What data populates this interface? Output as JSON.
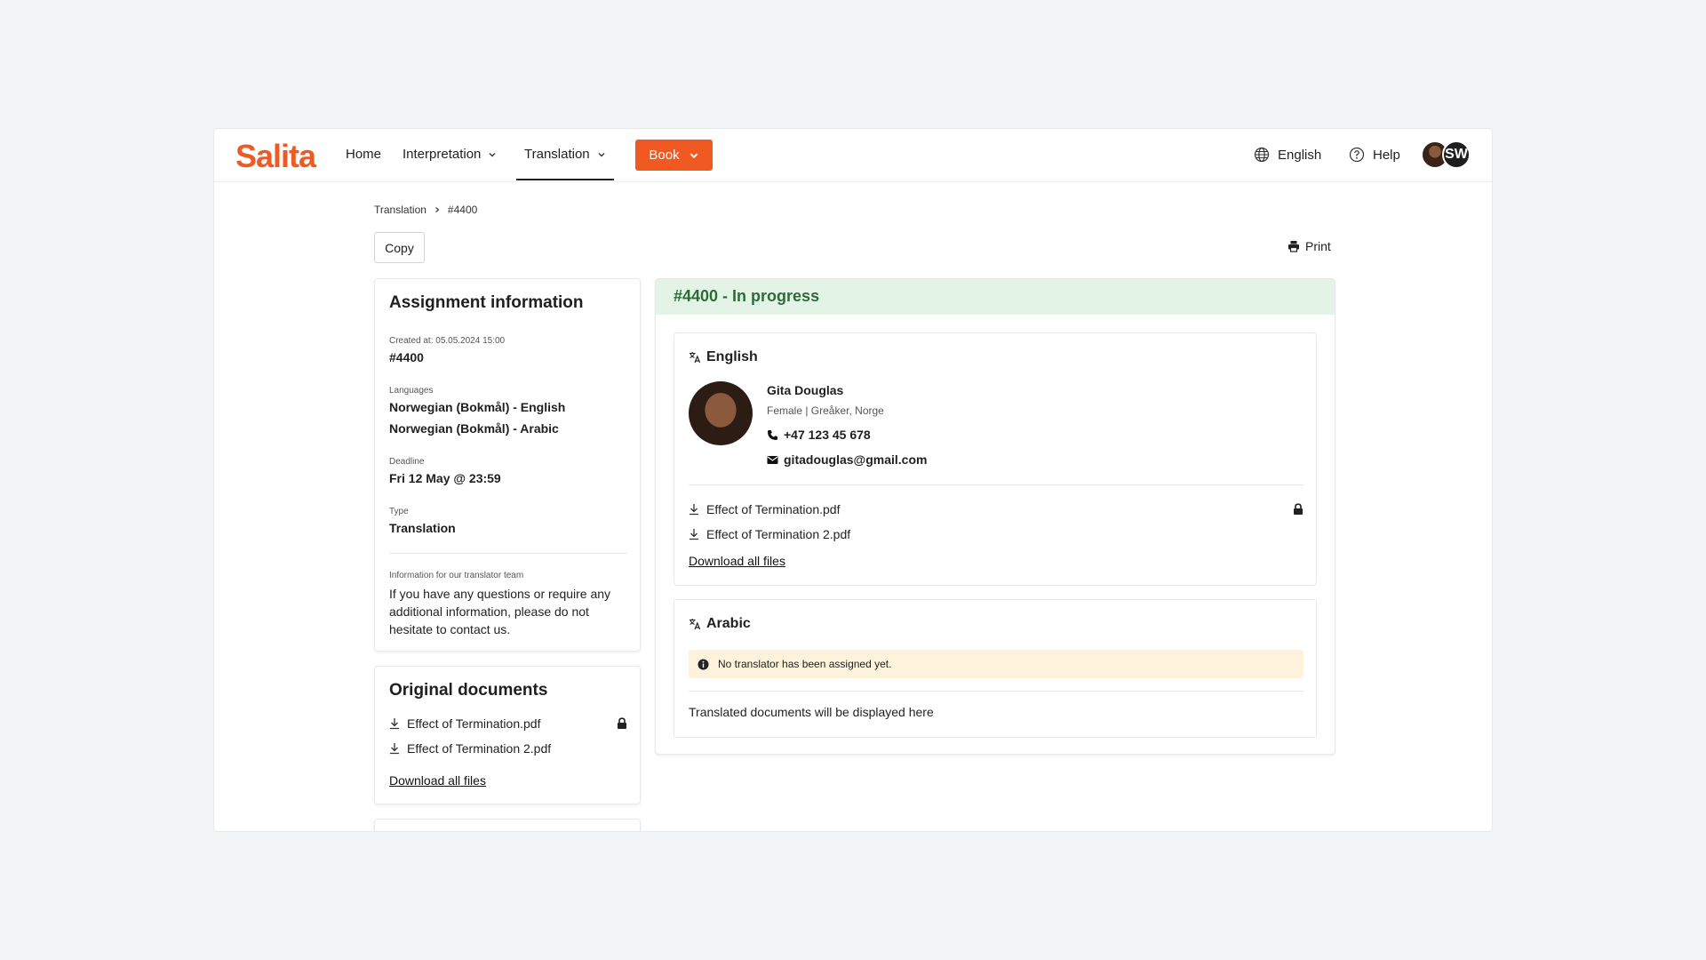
{
  "brand": {
    "logo_text": "Salita",
    "accent": "#ee5a24"
  },
  "nav": {
    "home": "Home",
    "interpretation": "Interpretation",
    "translation": "Translation",
    "book": "Book"
  },
  "header_right": {
    "language": "English",
    "help": "Help",
    "avatar_initials": "SW"
  },
  "breadcrumb": {
    "parent": "Translation",
    "current": "#4400"
  },
  "actions": {
    "copy": "Copy",
    "print": "Print"
  },
  "assignment": {
    "title": "Assignment information",
    "created_label": "Created at: 05.05.2024 15:00",
    "id": "#4400",
    "languages_label": "Languages",
    "languages": [
      "Norwegian (Bokmål) - English",
      "Norwegian (Bokmål) - Arabic"
    ],
    "deadline_label": "Deadline",
    "deadline": "Fri 12 May @ 23:59",
    "type_label": "Type",
    "type": "Translation",
    "info_label": "Information for our translator team",
    "info_text": "If you have any questions or require any additional information, please do not hesitate to contact us."
  },
  "original_documents": {
    "title": "Original documents",
    "files": [
      "Effect of Termination.pdf",
      "Effect of Termination 2.pdf"
    ],
    "download_all": "Download all files"
  },
  "status": {
    "text": "#4400 - In progress",
    "color": "#2f6b3a",
    "bg": "#e3f4e6"
  },
  "english": {
    "language": "English",
    "translator": {
      "name": "Gita Douglas",
      "details": "Female | Greåker, Norge",
      "phone": "+47 123 45 678",
      "email": "gitadouglas@gmail.com"
    },
    "files": [
      "Effect of Termination.pdf",
      "Effect of Termination 2.pdf"
    ],
    "download_all": "Download all files"
  },
  "arabic": {
    "language": "Arabic",
    "warning": "No translator has been assigned yet.",
    "placeholder": "Translated documents will be displayed here"
  }
}
